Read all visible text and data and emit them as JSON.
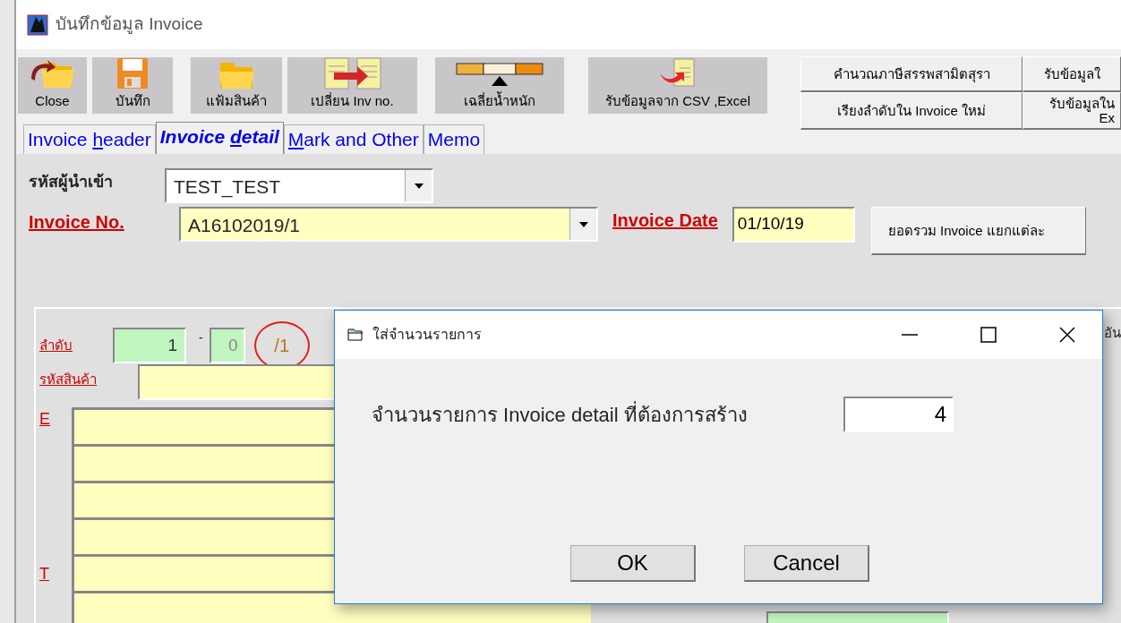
{
  "window": {
    "title": "บันทึกข้อมูล Invoice"
  },
  "toolbar": [
    {
      "label": "Close",
      "kind": "close"
    },
    {
      "label": "บันทึก",
      "kind": "save"
    },
    {
      "label": "แฟ้มสินค้า",
      "kind": "folder"
    },
    {
      "label": "เปลี่ยน Inv no.",
      "kind": "swap"
    },
    {
      "label": "เฉลี่ยน้ำหนัก",
      "kind": "balance"
    },
    {
      "label": "รับข้อมูลจาก CSV ,Excel",
      "kind": "import"
    }
  ],
  "side_buttons": [
    {
      "label": "คำนวณภาษีสรรพสามิตสุรา"
    },
    {
      "label": "รับข้อมูลใ"
    },
    {
      "label": "เรียงลำดับใน Invoice ใหม่"
    },
    {
      "label": "รับข้อมูลใน\nEx"
    }
  ],
  "tabs": [
    {
      "label_parts": [
        {
          "text": "Invoice ",
          "underline": false
        },
        {
          "text": "h",
          "underline": true
        },
        {
          "text": "eader",
          "underline": false
        }
      ],
      "selected": false
    },
    {
      "label_parts": [
        {
          "text": "Invoice ",
          "underline": false
        },
        {
          "text": "d",
          "underline": true
        },
        {
          "text": "etail",
          "underline": false
        }
      ],
      "selected": true
    },
    {
      "label_parts": [
        {
          "text": "M",
          "underline": true
        },
        {
          "text": "ark and Other",
          "underline": false
        }
      ],
      "selected": false
    },
    {
      "label_parts": [
        {
          "text": "Memo",
          "underline": false
        }
      ],
      "selected": false
    }
  ],
  "form": {
    "importer": {
      "label": "รหัสผู้นำเข้า",
      "value": "TEST_TEST"
    },
    "invoice_no": {
      "label": "Invoice No.",
      "value": "A16102019/1"
    },
    "invoice_date": {
      "label": "Invoice Date",
      "value": "01/10/19"
    },
    "summary_button": "ยอดรวม Invoice แยกแต่ละ"
  },
  "detail": {
    "seq_label": "ลำดับ",
    "seq": "1",
    "separator": "-",
    "sub": "0",
    "total": "/1",
    "product_label": "รหัสสินค้า",
    "label_e": "E",
    "label_t": "T",
    "right_label": "อัน"
  },
  "dialog": {
    "title": "ใส่จำนวนรายการ",
    "prompt": "จำนวนรายการ Invoice detail ที่ต้องการสร้าง",
    "value": "4",
    "buttons": [
      "OK",
      "Cancel"
    ]
  }
}
